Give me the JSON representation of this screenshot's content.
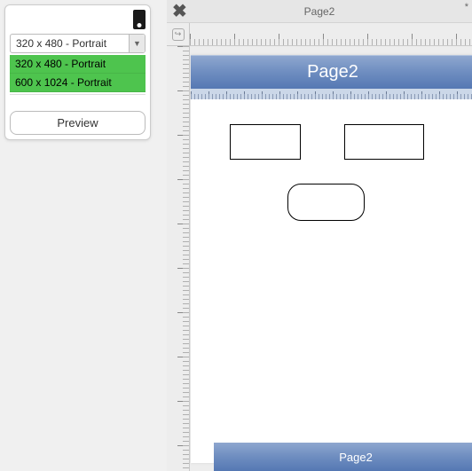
{
  "sidebar": {
    "size_select_value": "320 x 480 - Portrait",
    "options": [
      "320 x 480 - Portrait",
      "600 x 1024 - Portrait"
    ],
    "preview_label": "Preview"
  },
  "main": {
    "window_title": "Page2",
    "dirty_indicator": "*",
    "page_header": "Page2",
    "page_footer": "Page2"
  }
}
